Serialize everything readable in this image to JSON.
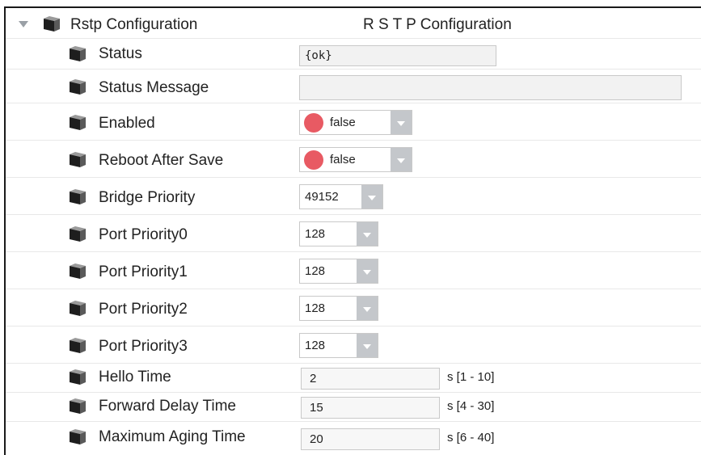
{
  "folder": {
    "name": "Rstp Configuration",
    "display": "R S T P Configuration",
    "icon": "cube-icon",
    "expander_icon": "caret-down-icon"
  },
  "properties": {
    "status": {
      "label": "Status",
      "value": "{ok}"
    },
    "status_message": {
      "label": "Status Message",
      "value": ""
    },
    "enabled": {
      "label": "Enabled",
      "value": "false",
      "indicator_color": "#e85a63"
    },
    "reboot_after_save": {
      "label": "Reboot After Save",
      "value": "false",
      "indicator_color": "#e85a63"
    },
    "bridge_priority": {
      "label": "Bridge Priority",
      "value": "49152"
    },
    "port_priority0": {
      "label": "Port Priority0",
      "value": "128"
    },
    "port_priority1": {
      "label": "Port Priority1",
      "value": "128"
    },
    "port_priority2": {
      "label": "Port Priority2",
      "value": "128"
    },
    "port_priority3": {
      "label": "Port Priority3",
      "value": "128"
    },
    "hello_time": {
      "label": "Hello Time",
      "value": "2",
      "range": "s [1 - 10]"
    },
    "forward_delay_time": {
      "label": "Forward Delay Time",
      "value": "15",
      "range": "s [4 - 30]"
    },
    "maximum_aging_time": {
      "label": "Maximum Aging Time",
      "value": "20",
      "range": "s [6 - 40]"
    }
  },
  "colors": {
    "dropdown_arrow_bg": "#c4c7cb",
    "false_indicator": "#e85a63",
    "field_bg": "#f2f2f2"
  }
}
